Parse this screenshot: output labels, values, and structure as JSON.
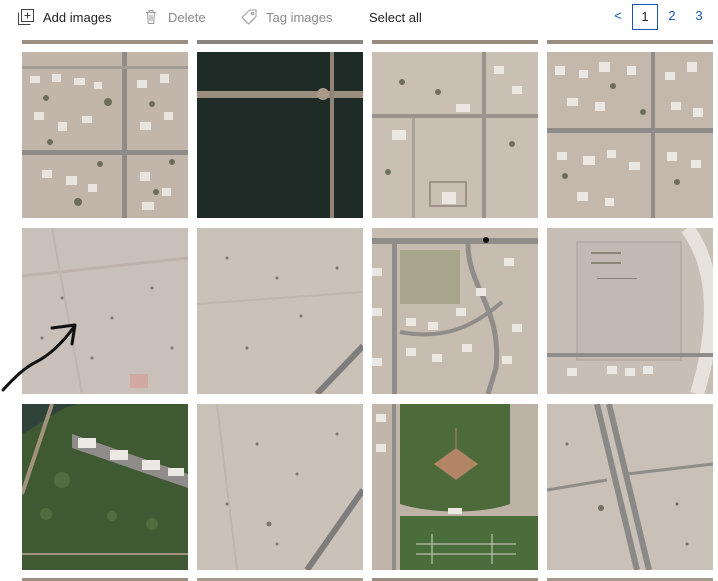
{
  "toolbar": {
    "add_images": "Add images",
    "delete": "Delete",
    "tag_images": "Tag images",
    "select_all": "Select all"
  },
  "pagination": {
    "prev": "<",
    "pages": [
      "1",
      "2",
      "3"
    ],
    "current_page": "1"
  },
  "gallery": {
    "tiles": [
      {
        "name": "image-tile-r1c1",
        "kind": "residential"
      },
      {
        "name": "image-tile-r1c2",
        "kind": "water"
      },
      {
        "name": "image-tile-r1c3",
        "kind": "residential-sparse"
      },
      {
        "name": "image-tile-r1c4",
        "kind": "residential"
      },
      {
        "name": "image-tile-r2c1",
        "kind": "desert"
      },
      {
        "name": "image-tile-r2c2",
        "kind": "desert-road"
      },
      {
        "name": "image-tile-r2c3",
        "kind": "curved-street"
      },
      {
        "name": "image-tile-r2c4",
        "kind": "lot"
      },
      {
        "name": "image-tile-r3c1",
        "kind": "green-park"
      },
      {
        "name": "image-tile-r3c2",
        "kind": "desert-road"
      },
      {
        "name": "image-tile-r3c3",
        "kind": "baseball-field"
      },
      {
        "name": "image-tile-r3c4",
        "kind": "highway"
      }
    ]
  },
  "colors": {
    "accent": "#1a56b0",
    "desert": "#c4b9ab",
    "road": "#8f8c8a",
    "water": "#1e2b26",
    "grass": "#3f5a33"
  }
}
